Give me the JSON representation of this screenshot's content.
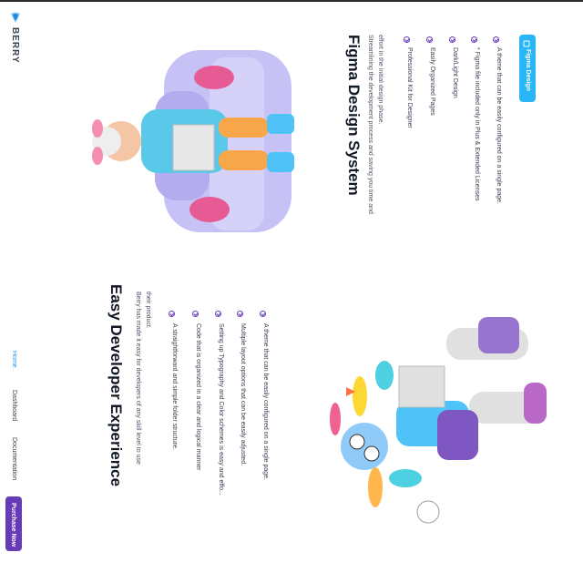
{
  "brand": {
    "name": "BERRY"
  },
  "nav": {
    "home": "Home",
    "dashboard": "Dashboard",
    "documentation": "Documentation",
    "purchase": "Purchase Now"
  },
  "developer": {
    "title": "Easy Developer Experience",
    "description_line1": "Berry has made it easy for developers of any skill level to use",
    "description_line2": "their product.",
    "features": [
      "A theme that can be easily configured on a single page.",
      "Multiple layout options that can be easily adjusted.",
      "Setting up Typography and Color schemes is easy and effo...",
      "Code that is organized in a clear and logical manner",
      "A straightforward and simple folder structure."
    ]
  },
  "figma": {
    "title": "Figma Design System",
    "description_line1": "Streamlining the development process and saving you time and",
    "description_line2": "effort in the initial design phase.",
    "features": [
      "A theme that can be easily configured on a single page.",
      "* Figma file included only in Plus & Extended Licenses",
      "Dark/Light Design",
      "Easily Organized Pages",
      "Professional Kit for Designer"
    ],
    "button": "Figma Design"
  },
  "colors": {
    "primary": "#673ab7",
    "secondary": "#2196f3",
    "figma_button": "#29b6f6",
    "sofa": "#c6c2f5"
  }
}
